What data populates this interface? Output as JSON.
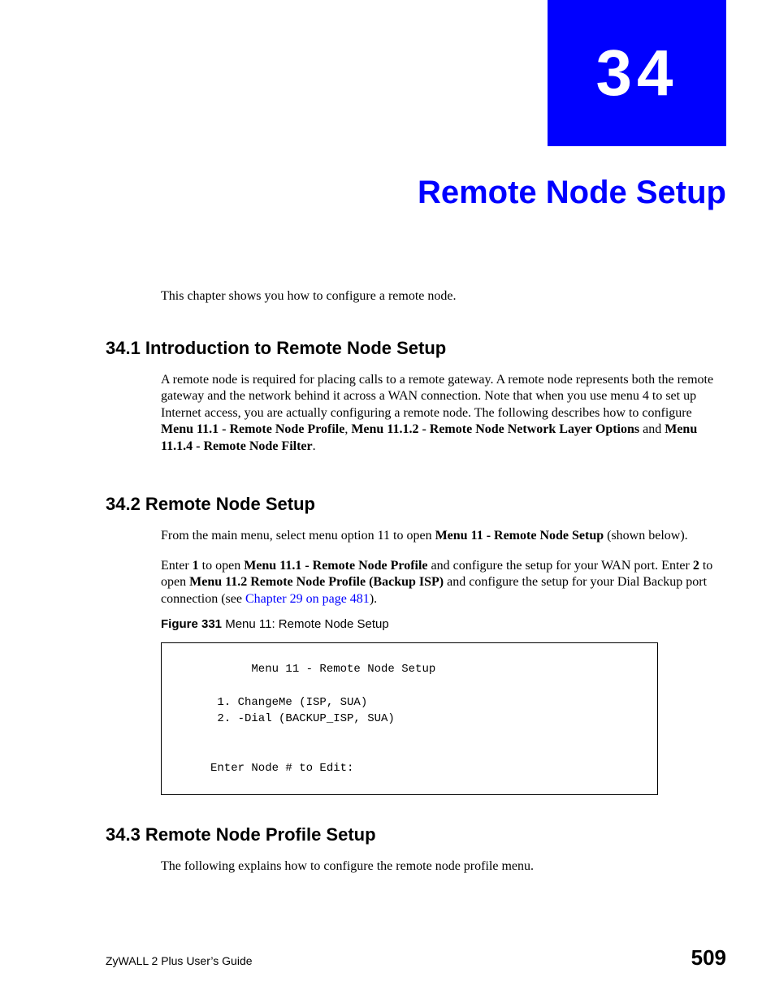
{
  "chapter": {
    "number": "34",
    "title": "Remote Node Setup"
  },
  "intro": "This chapter shows you how to configure a remote node.",
  "sections": {
    "s1": {
      "heading": "34.1  Introduction to Remote Node Setup",
      "p1_a": "A remote node is required for placing calls to a remote gateway. A remote node represents both the remote gateway and the network behind it across a WAN connection. Note that when you use menu 4 to set up Internet access, you are actually configuring a remote node. The following describes how to configure ",
      "p1_b1": "Menu 11.1 - Remote Node Profile",
      "p1_c": ", ",
      "p1_b2": "Menu 11.1.2 - Remote Node Network Layer Options",
      "p1_d": " and ",
      "p1_b3": "Menu 11.1.4 - Remote Node Filter",
      "p1_e": "."
    },
    "s2": {
      "heading": "34.2  Remote Node Setup",
      "p1_a": "From the main menu, select menu option 11 to open ",
      "p1_b1": "Menu 11 - Remote Node Setup",
      "p1_c": " (shown below).",
      "p2_a": "Enter ",
      "p2_b1": "1",
      "p2_c": " to open ",
      "p2_b2": "Menu 11.1 - Remote Node Profile",
      "p2_d": " and configure the setup for your WAN port. Enter ",
      "p2_b3": "2",
      "p2_e": " to open ",
      "p2_b4": "Menu 11.2 Remote Node Profile (Backup ISP)",
      "p2_f": " and configure the setup for your Dial Backup port connection (see ",
      "p2_link": "Chapter 29 on page 481",
      "p2_g": ").",
      "figure_label_bold": "Figure 331   ",
      "figure_label_rest": "Menu 11: Remote Node Setup",
      "menu_text": "      Menu 11 - Remote Node Setup\n\n 1. ChangeMe (ISP, SUA)\n 2. -Dial (BACKUP_ISP, SUA)\n\n\nEnter Node # to Edit:"
    },
    "s3": {
      "heading": "34.3  Remote Node Profile Setup",
      "p1": "The following explains how to configure the remote node profile menu."
    }
  },
  "footer": {
    "left": "ZyWALL 2 Plus User’s Guide",
    "right": "509"
  }
}
